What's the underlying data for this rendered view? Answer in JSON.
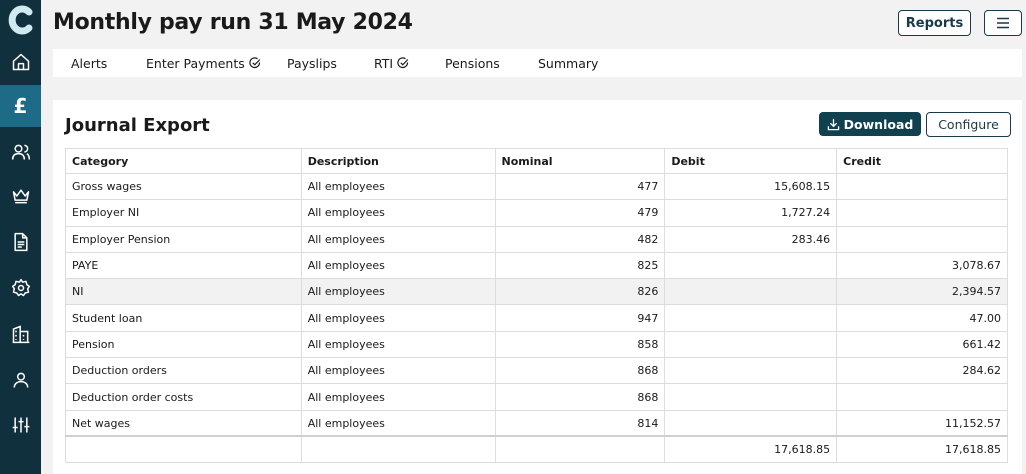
{
  "header": {
    "title": "Monthly pay run 31 May 2024",
    "reports_label": "Reports"
  },
  "sidebar": {
    "items": [
      {
        "name": "home-icon"
      },
      {
        "name": "pound-icon",
        "label": "£",
        "active": true
      },
      {
        "name": "employees-icon"
      },
      {
        "name": "crown-icon"
      },
      {
        "name": "document-icon"
      },
      {
        "name": "settings-icon"
      },
      {
        "name": "buildings-icon"
      },
      {
        "name": "user-icon"
      },
      {
        "name": "sliders-icon"
      }
    ]
  },
  "tabs": [
    {
      "label": "Alerts",
      "check": false
    },
    {
      "label": "Enter Payments",
      "check": true
    },
    {
      "label": "Payslips",
      "check": false
    },
    {
      "label": "RTI",
      "check": true
    },
    {
      "label": "Pensions",
      "check": false
    },
    {
      "label": "Summary",
      "check": false
    }
  ],
  "journal": {
    "title": "Journal Export",
    "download_label": "Download",
    "configure_label": "Configure",
    "columns": [
      "Category",
      "Description",
      "Nominal",
      "Debit",
      "Credit"
    ],
    "rows": [
      {
        "category": "Gross wages",
        "description": "All employees",
        "nominal": "477",
        "debit": "15,608.15",
        "credit": ""
      },
      {
        "category": "Employer NI",
        "description": "All employees",
        "nominal": "479",
        "debit": "1,727.24",
        "credit": ""
      },
      {
        "category": "Employer Pension",
        "description": "All employees",
        "nominal": "482",
        "debit": "283.46",
        "credit": ""
      },
      {
        "category": "PAYE",
        "description": "All employees",
        "nominal": "825",
        "debit": "",
        "credit": "3,078.67"
      },
      {
        "category": "NI",
        "description": "All employees",
        "nominal": "826",
        "debit": "",
        "credit": "2,394.57"
      },
      {
        "category": "Student loan",
        "description": "All employees",
        "nominal": "947",
        "debit": "",
        "credit": "47.00"
      },
      {
        "category": "Pension",
        "description": "All employees",
        "nominal": "858",
        "debit": "",
        "credit": "661.42"
      },
      {
        "category": "Deduction orders",
        "description": "All employees",
        "nominal": "868",
        "debit": "",
        "credit": "284.62"
      },
      {
        "category": "Deduction order costs",
        "description": "All employees",
        "nominal": "868",
        "debit": "",
        "credit": ""
      },
      {
        "category": "Net wages",
        "description": "All employees",
        "nominal": "814",
        "debit": "",
        "credit": "11,152.57"
      }
    ],
    "totals": {
      "debit": "17,618.85",
      "credit": "17,618.85"
    }
  },
  "colors": {
    "sidebar": "#11303d",
    "sidebar_active": "#1d6b87",
    "primary": "#11404f"
  }
}
